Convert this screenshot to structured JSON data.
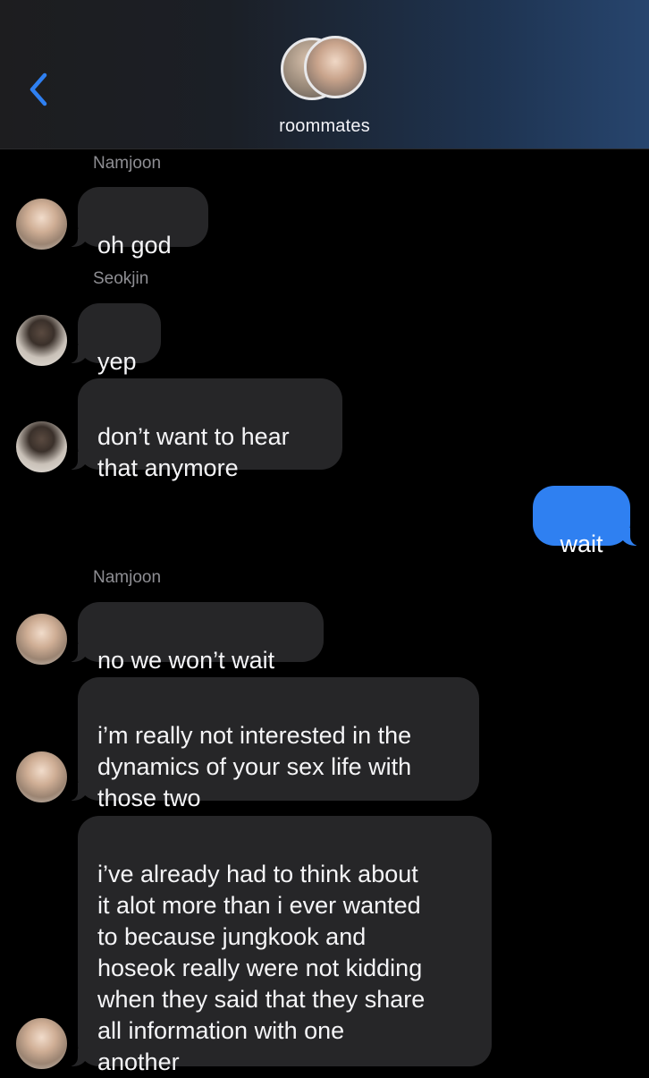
{
  "header": {
    "title": "roommates",
    "back_icon": "chevron-left-icon",
    "accent": "#2f80f1"
  },
  "messages": [
    {
      "type": "sender",
      "text": "Namjoon"
    },
    {
      "type": "in",
      "text": "oh god",
      "avatar": "namjoon"
    },
    {
      "type": "sender",
      "text": "Seokjin"
    },
    {
      "type": "in",
      "text": "yep",
      "avatar": "seokjin"
    },
    {
      "type": "in",
      "text": "don’t want to hear\nthat anymore",
      "avatar": "seokjin"
    },
    {
      "type": "out",
      "text": "wait"
    },
    {
      "type": "sender",
      "text": "Namjoon"
    },
    {
      "type": "in",
      "text": "no we won’t wait",
      "avatar": "namjoon"
    },
    {
      "type": "in",
      "text": "i’m really not interested in the\ndynamics of your sex life with\nthose two",
      "avatar": "namjoon"
    },
    {
      "type": "in",
      "text": "i’ve already had to think about\nit alot more than i ever wanted\nto because jungkook and\nhoseok really were not kidding\nwhen they said that they share\nall information with one\nanother",
      "avatar": "namjoon"
    }
  ],
  "colors": {
    "incoming_bubble": "#262628",
    "outgoing_bubble": "#2f80f1",
    "sender_name": "#8e8e93",
    "background": "#000000"
  }
}
